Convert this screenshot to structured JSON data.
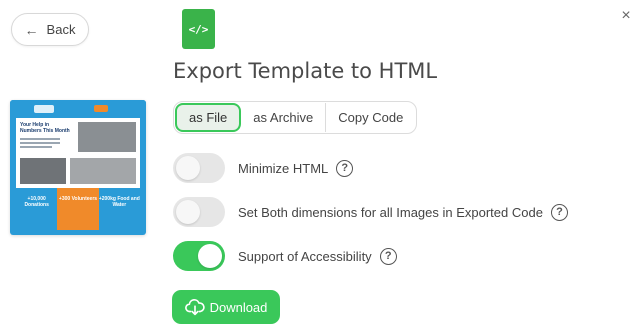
{
  "header": {
    "back_label": "Back",
    "back_icon": "arrow-left-icon",
    "close_icon": "close-icon",
    "close_glyph": "×"
  },
  "file_icon": {
    "name": "code-file-icon",
    "glyph": "</>",
    "color": "#3ab34a"
  },
  "title": "Export Template to HTML",
  "export_modes": {
    "options": [
      "as File",
      "as Archive",
      "Copy Code"
    ],
    "selected": "as File"
  },
  "options": [
    {
      "label": "Minimize HTML",
      "enabled": false,
      "help": "?"
    },
    {
      "label": "Set Both dimensions for all Images in Exported Code",
      "enabled": false,
      "help": "?"
    },
    {
      "label": "Support of Accessibility",
      "enabled": true,
      "help": "?"
    }
  ],
  "download": {
    "label": "Download",
    "icon": "cloud-download-icon"
  },
  "colors": {
    "accent_green": "#3ac85a",
    "thumb_blue": "#2a9bd7",
    "thumb_orange": "#f08a2a"
  },
  "preview": {
    "headline": "Your Help in Numbers This Month",
    "stats": [
      "+10,000 Donations",
      "+300 Volunteers",
      "+200kg Food and Water"
    ]
  }
}
